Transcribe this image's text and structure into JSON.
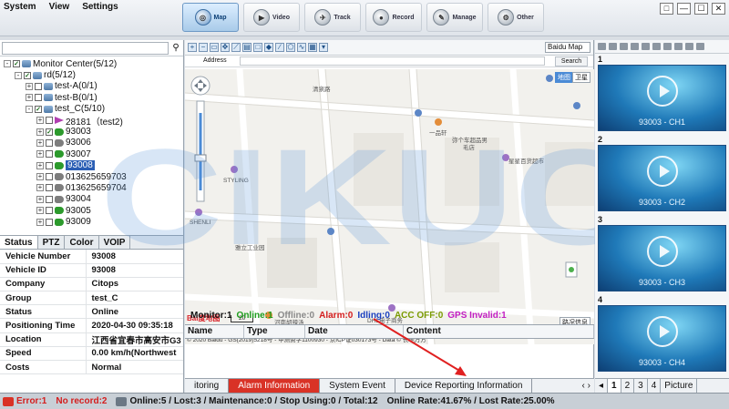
{
  "menu": [
    "System",
    "View",
    "Settings"
  ],
  "nav": [
    {
      "label": "Map",
      "icon": "map-icon"
    },
    {
      "label": "Video",
      "icon": "video-icon"
    },
    {
      "label": "Track",
      "icon": "track-icon"
    },
    {
      "label": "Record",
      "icon": "record-icon"
    },
    {
      "label": "Manage",
      "icon": "manage-icon"
    },
    {
      "label": "Other",
      "icon": "other-icon"
    }
  ],
  "window_controls": [
    "□",
    "—",
    "☐",
    "✕"
  ],
  "tree": [
    {
      "label": "Monitor Center(5/12)",
      "level": 0,
      "expander": "-",
      "checked": true,
      "icon": "group"
    },
    {
      "label": "rd(5/12)",
      "level": 1,
      "expander": "-",
      "checked": true,
      "icon": "group"
    },
    {
      "label": "test-A(0/1)",
      "level": 2,
      "expander": "+",
      "checked": false,
      "icon": "group"
    },
    {
      "label": "test-B(0/1)",
      "level": 2,
      "expander": "+",
      "checked": false,
      "icon": "group"
    },
    {
      "label": "test_C(5/10)",
      "level": 2,
      "expander": "-",
      "checked": true,
      "icon": "group"
    },
    {
      "label": "28181（test2)",
      "level": 3,
      "expander": "+",
      "checked": false,
      "icon": "purple"
    },
    {
      "label": "93003",
      "level": 3,
      "expander": "+",
      "checked": true,
      "icon": "green"
    },
    {
      "label": "93006",
      "level": 3,
      "expander": "+",
      "checked": false,
      "icon": "gray"
    },
    {
      "label": "93007",
      "level": 3,
      "expander": "+",
      "checked": false,
      "icon": "green"
    },
    {
      "label": "93008",
      "level": 3,
      "expander": "+",
      "checked": false,
      "icon": "green",
      "selected": true
    },
    {
      "label": "013625659703",
      "level": 3,
      "expander": "+",
      "checked": false,
      "icon": "gray"
    },
    {
      "label": "013625659704",
      "level": 3,
      "expander": "+",
      "checked": false,
      "icon": "gray"
    },
    {
      "label": "93004",
      "level": 3,
      "expander": "+",
      "checked": false,
      "icon": "gray"
    },
    {
      "label": "93005",
      "level": 3,
      "expander": "+",
      "checked": false,
      "icon": "green"
    },
    {
      "label": "93009",
      "level": 3,
      "expander": "+",
      "checked": false,
      "icon": "green"
    }
  ],
  "left_tabs": [
    "Status",
    "PTZ",
    "Color",
    "VOIP"
  ],
  "props": [
    {
      "k": "Vehicle Number",
      "v": "93008"
    },
    {
      "k": "Vehicle ID",
      "v": "93008"
    },
    {
      "k": "Company",
      "v": "Citops"
    },
    {
      "k": "Group",
      "v": "test_C"
    },
    {
      "k": "Status",
      "v": "Online"
    },
    {
      "k": "Positioning Time",
      "v": "2020-04-30 09:35:18"
    },
    {
      "k": "Location",
      "v": "江西省宜春市高安市G3"
    },
    {
      "k": "Speed",
      "v": "0.00 km/h(Northwest"
    },
    {
      "k": "Costs",
      "v": "Normal"
    }
  ],
  "map": {
    "type_select": "Baidu Map",
    "address_label": "Address",
    "search_label": "Search",
    "btn_map": "地图",
    "btn_sat": "卫星",
    "traffic": "路况信息",
    "scale": "20",
    "labels": [
      {
        "text": "清泉路"
      },
      {
        "text": "一品轩"
      },
      {
        "text": "弥个车超品男"
      },
      {
        "text": "毛店"
      },
      {
        "text": "星星百货超市"
      },
      {
        "text": "STYLING"
      },
      {
        "text": "SHENLI"
      },
      {
        "text": "雅立工业园"
      },
      {
        "text": "河南胡辣汤"
      },
      {
        "text": "DHL电子商务"
      }
    ],
    "copyright": "© 2020 Baidu - GS(2019)5218号 - 甲测资字1100930 - 京ICP证030173号 - Data © 长地万方",
    "baidu_logo": "Bai度地图"
  },
  "watermark": "CIKUCI",
  "status": {
    "monitor": "Monitor:1",
    "online": "Online:1",
    "offline": "Offline:0",
    "alarm": "Alarm:0",
    "idling": "Idling:0",
    "accoff": "ACC OFF:0",
    "gps": "GPS Invalid:1",
    "colors": {
      "online": "#1c9c1c",
      "offline": "#8a8a8a",
      "alarm": "#d41d1d",
      "idling": "#1a3fbf",
      "accoff": "#7a9a00",
      "gps": "#c21dc2"
    }
  },
  "grid_headers": [
    "Name",
    "Type",
    "Date",
    "Content"
  ],
  "bottom_tabs": [
    "itoring",
    "Alarm Information",
    "System Event",
    "Device Reporting Information"
  ],
  "videos": [
    {
      "num": "1",
      "label": "93003 - CH1"
    },
    {
      "num": "2",
      "label": "93003 - CH2"
    },
    {
      "num": "3",
      "label": "93003 - CH3"
    },
    {
      "num": "4",
      "label": "93003 - CH4"
    }
  ],
  "page_tabs": [
    "1",
    "2",
    "3",
    "4",
    "Picture"
  ],
  "footer": {
    "error": "Error:1",
    "norecord": "No record:2",
    "summary": "Online:5 / Lost:3 / Maintenance:0 / Stop Using:0 / Total:12",
    "rate": "Online Rate:41.67% / Lost Rate:25.00%"
  }
}
